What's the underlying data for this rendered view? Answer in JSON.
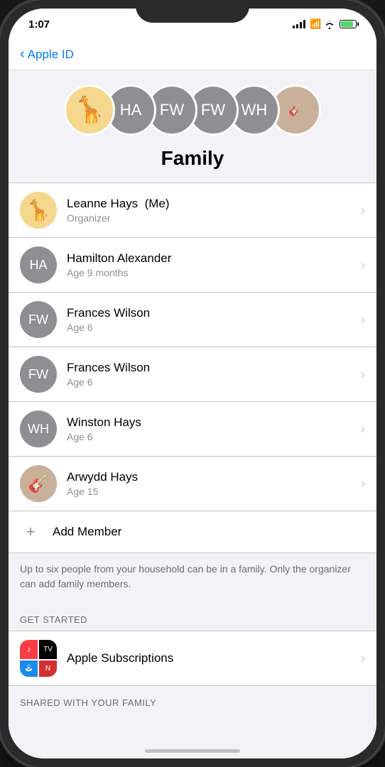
{
  "status": {
    "time": "1:07",
    "location_icon": "›",
    "signal_level": 3,
    "wifi": true,
    "battery_pct": 80
  },
  "nav": {
    "back_label": "Apple ID",
    "back_icon": "‹"
  },
  "family": {
    "title": "Family",
    "members": [
      {
        "id": "leanne",
        "name": "Leanne Hays",
        "badge": "(Me)",
        "sub": "Organizer",
        "initials": "",
        "avatar_type": "giraffe",
        "color": "giraffe"
      },
      {
        "id": "hamilton",
        "name": "Hamilton Alexander",
        "badge": "",
        "sub": "Age 9 months",
        "initials": "HA",
        "avatar_type": "initials",
        "color": "gray"
      },
      {
        "id": "frances1",
        "name": "Frances Wilson",
        "badge": "",
        "sub": "Age 6",
        "initials": "FW",
        "avatar_type": "initials",
        "color": "gray"
      },
      {
        "id": "frances2",
        "name": "Frances Wilson",
        "badge": "",
        "sub": "Age 6",
        "initials": "FW",
        "avatar_type": "initials",
        "color": "gray"
      },
      {
        "id": "winston",
        "name": "Winston Hays",
        "badge": "",
        "sub": "Age 6",
        "initials": "WH",
        "avatar_type": "initials",
        "color": "gray"
      },
      {
        "id": "arwydd",
        "name": "Arwydd Hays",
        "badge": "",
        "sub": "Age 15",
        "initials": "",
        "avatar_type": "guitar",
        "color": "guitar"
      }
    ],
    "add_member_label": "Add Member",
    "info_text": "Up to six people from your household can be in a family. Only the organizer can add family members.",
    "get_started_header": "GET STARTED",
    "subscriptions_label": "Apple Subscriptions",
    "shared_header": "SHARED WITH YOUR FAMILY"
  }
}
